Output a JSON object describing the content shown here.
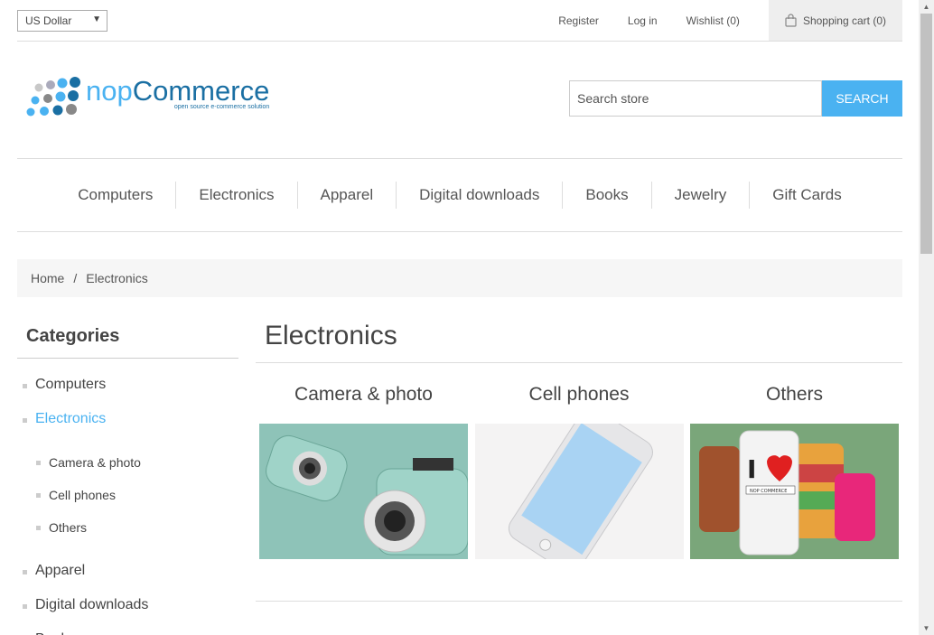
{
  "header": {
    "currency": "US Dollar",
    "register": "Register",
    "login": "Log in",
    "wishlist": "Wishlist (0)",
    "cart": "Shopping cart (0)"
  },
  "logo": {
    "word_a": "nop",
    "word_b": "Commerce",
    "tagline": "open source e-commerce solution"
  },
  "search": {
    "placeholder": "Search store",
    "button": "SEARCH"
  },
  "nav": [
    "Computers",
    "Electronics",
    "Apparel",
    "Digital downloads",
    "Books",
    "Jewelry",
    "Gift Cards"
  ],
  "breadcrumb": {
    "home": "Home",
    "sep": "/",
    "current": "Electronics"
  },
  "sidebar": {
    "title": "Categories",
    "items": [
      "Computers",
      "Electronics",
      "Apparel",
      "Digital downloads",
      "Books"
    ],
    "subitems": [
      "Camera & photo",
      "Cell phones",
      "Others"
    ]
  },
  "main": {
    "title": "Electronics",
    "categories": [
      {
        "title": "Camera & photo"
      },
      {
        "title": "Cell phones"
      },
      {
        "title": "Others"
      }
    ]
  },
  "others_img": {
    "sticker": "NOP COMMERCE"
  }
}
